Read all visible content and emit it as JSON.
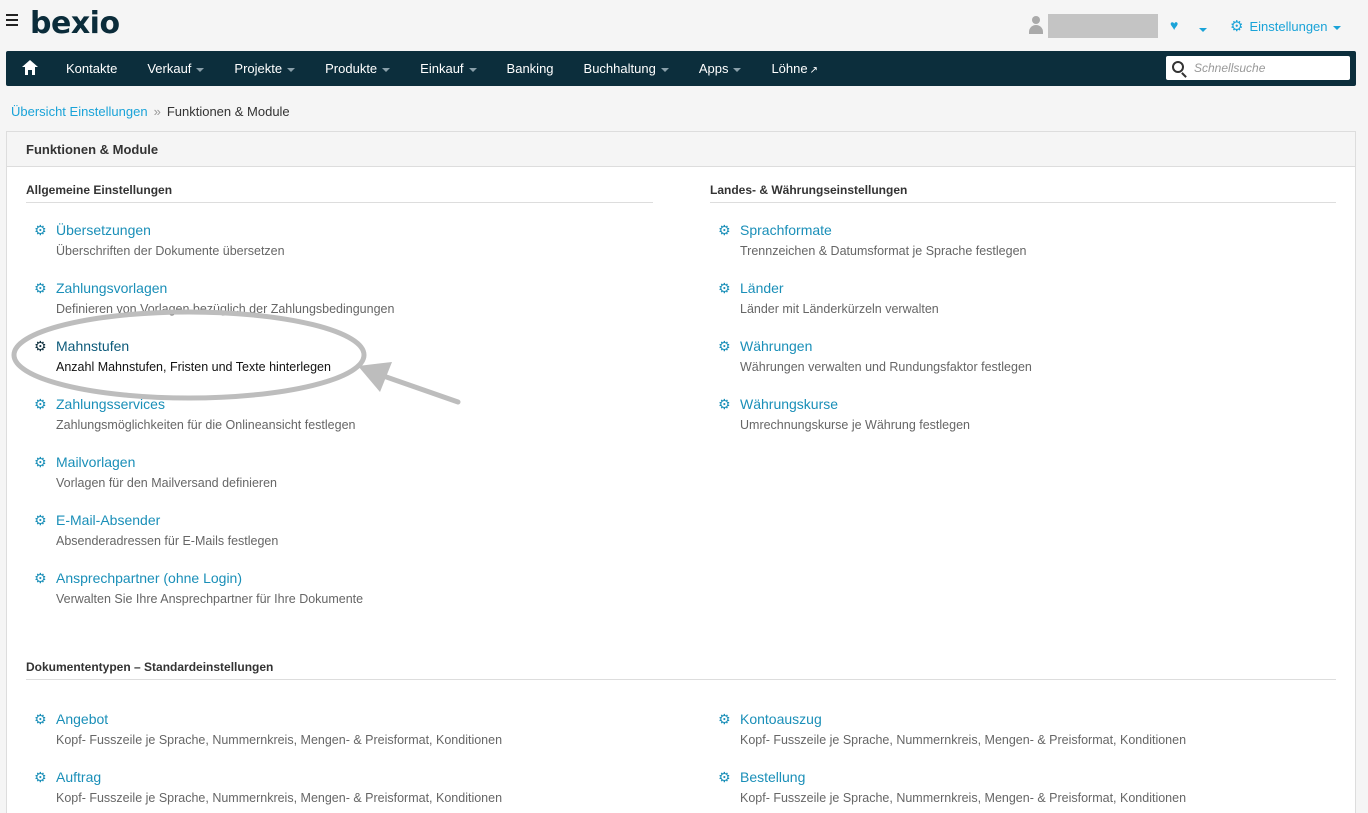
{
  "app": {
    "logo": "bexio",
    "settings_label": "Einstellungen"
  },
  "nav": {
    "items": [
      "Kontakte",
      "Verkauf",
      "Projekte",
      "Produkte",
      "Einkauf",
      "Banking",
      "Buchhaltung",
      "Apps",
      "Löhne"
    ],
    "search_placeholder": "Schnellsuche"
  },
  "breadcrumb": {
    "parent": "Übersicht Einstellungen",
    "separator": "»",
    "current": "Funktionen & Module"
  },
  "panel": {
    "title": "Funktionen & Module",
    "general": {
      "title": "Allgemeine Einstellungen",
      "items": [
        {
          "title": "Übersetzungen",
          "desc": "Überschriften der Dokumente übersetzen"
        },
        {
          "title": "Zahlungsvorlagen",
          "desc": "Definieren von Vorlagen bezüglich der Zahlungsbedingungen"
        },
        {
          "title": "Mahnstufen",
          "desc": "Anzahl Mahnstufen, Fristen und Texte hinterlegen"
        },
        {
          "title": "Zahlungsservices",
          "desc": "Zahlungsmöglichkeiten für die Onlineansicht festlegen"
        },
        {
          "title": "Mailvorlagen",
          "desc": "Vorlagen für den Mailversand definieren"
        },
        {
          "title": "E-Mail-Absender",
          "desc": "Absenderadressen für E-Mails festlegen"
        },
        {
          "title": "Ansprechpartner (ohne Login)",
          "desc": "Verwalten Sie Ihre Ansprechpartner für Ihre Dokumente"
        }
      ]
    },
    "locale": {
      "title": "Landes- & Währungseinstellungen",
      "items": [
        {
          "title": "Sprachformate",
          "desc": "Trennzeichen & Datumsformat je Sprache festlegen"
        },
        {
          "title": "Länder",
          "desc": "Länder mit Länderkürzeln verwalten"
        },
        {
          "title": "Währungen",
          "desc": "Währungen verwalten und Rundungsfaktor festlegen"
        },
        {
          "title": "Währungskurse",
          "desc": "Umrechnungskurse je Währung festlegen"
        }
      ]
    },
    "doctypes": {
      "title": "Dokumententypen – Standardeinstellungen",
      "items": [
        {
          "title": "Angebot",
          "desc": "Kopf- Fusszeile je Sprache, Nummernkreis, Mengen- & Preisformat, Konditionen"
        },
        {
          "title": "Kontoauszug",
          "desc": "Kopf- Fusszeile je Sprache, Nummernkreis, Mengen- & Preisformat, Konditionen"
        },
        {
          "title": "Auftrag",
          "desc": "Kopf- Fusszeile je Sprache, Nummernkreis, Mengen- & Preisformat, Konditionen"
        },
        {
          "title": "Bestellung",
          "desc": "Kopf- Fusszeile je Sprache, Nummernkreis, Mengen- & Preisformat, Konditionen"
        }
      ]
    }
  },
  "colors": {
    "nav_bg": "#0c2e3c",
    "link": "#1a8fb8",
    "accent": "#1aa3d8"
  }
}
